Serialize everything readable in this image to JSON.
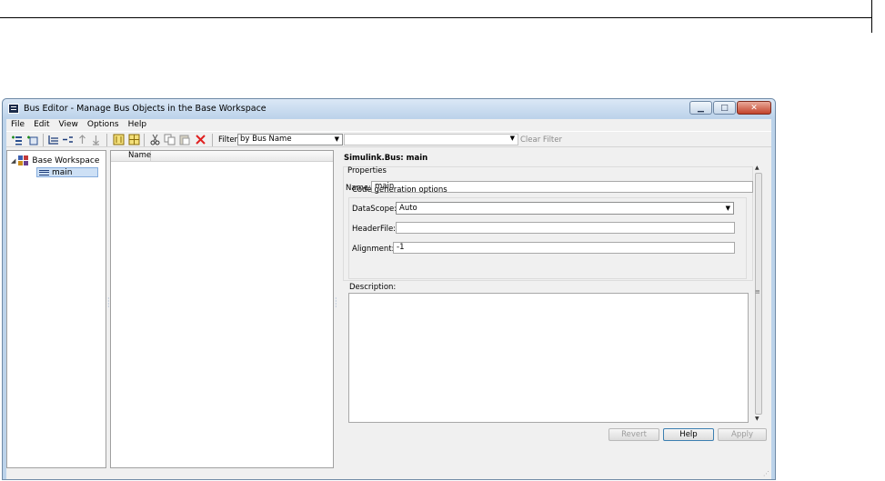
{
  "window": {
    "title": "Bus Editor - Manage Bus Objects in the Base Workspace",
    "controls": {
      "minimize": "▁",
      "maximize": "□",
      "close": "✕"
    }
  },
  "menu": [
    "File",
    "Edit",
    "View",
    "Options",
    "Help"
  ],
  "toolbar": {
    "icons": [
      "add-bus-icon",
      "add-element-icon",
      "insert-icon",
      "expand-icon",
      "move-up-icon",
      "move-down-icon",
      "browser-icon",
      "grid-icon",
      "cut-icon",
      "copy-icon",
      "paste-icon",
      "delete-icon"
    ],
    "filter_label": "Filter:",
    "filter_mode": "by Bus Name",
    "filter_text": "",
    "clear_filter": "Clear Filter"
  },
  "tree": {
    "root": "Base Workspace",
    "children": [
      "main"
    ]
  },
  "list": {
    "columns": [
      "Name"
    ]
  },
  "details": {
    "title": "Simulink.Bus: main",
    "properties_label": "Properties",
    "name_label": "Name:",
    "name_value": "main",
    "codegen_label": "Code generation options",
    "datascope_label": "DataScope:",
    "datascope_value": "Auto",
    "headerfile_label": "HeaderFile:",
    "headerfile_value": "",
    "alignment_label": "Alignment:",
    "alignment_value": "-1",
    "description_label": "Description:",
    "description_value": ""
  },
  "buttons": {
    "revert": "Revert",
    "help": "Help",
    "apply": "Apply"
  },
  "colors": {
    "window_frame": "#bcd3ea",
    "selection": "#cde0f5",
    "delete_red": "#e02020"
  }
}
